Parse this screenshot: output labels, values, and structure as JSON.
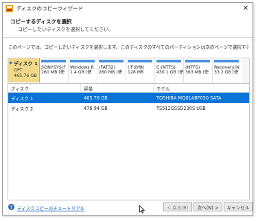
{
  "window": {
    "title": "ディスクのコピーウィザード",
    "close_glyph": "✕"
  },
  "header": {
    "title": "コピーするディスクを選択",
    "subtitle": "コピーしたいディスクを選択してください。"
  },
  "description": "このページでは、コピーしたいディスクを選択します。このディスクのすべてのパーティションは次のページで選択する行先ディスクにコピーされます。",
  "disk_map": {
    "disk_name": "ディスク 1",
    "disk_type": "GPT",
    "disk_size": "465.76 GB",
    "partitions": [
      {
        "name": "SONYSYS(F",
        "size": "260 MB (使"
      },
      {
        "name": "Windows R",
        "size": "1.4 GB (使"
      },
      {
        "name": "(FAT32)",
        "size": "260 MB (使"
      },
      {
        "name": "(その他)",
        "size": "128 MB"
      },
      {
        "name": "C:(NTFS)",
        "size": "430.1 GB (使"
      },
      {
        "name": "(NTFS)",
        "size": "363 MB (使"
      },
      {
        "name": "Recovery(N",
        "size": "33.2 GB (使"
      }
    ],
    "partition_color": "#4a90d9"
  },
  "table": {
    "columns": [
      "ディスク",
      "容量",
      "モデル"
    ],
    "rows": [
      {
        "disk": "ディスク 1",
        "capacity": "465.76 GB",
        "model": "TOSHIBA MQ01ABF050 SATA",
        "selected": true
      },
      {
        "disk": "ディスク 2",
        "capacity": "476.94 GB",
        "model": "TS512GSSD230S USB",
        "selected": false
      }
    ],
    "selection_color": "#0a73d6"
  },
  "footer": {
    "help_link": "ディスクコピーのチュートリアル",
    "back_label": "< 戻る(B)",
    "next_label": "次へ(N) >",
    "cancel_label": "キャンセル"
  }
}
